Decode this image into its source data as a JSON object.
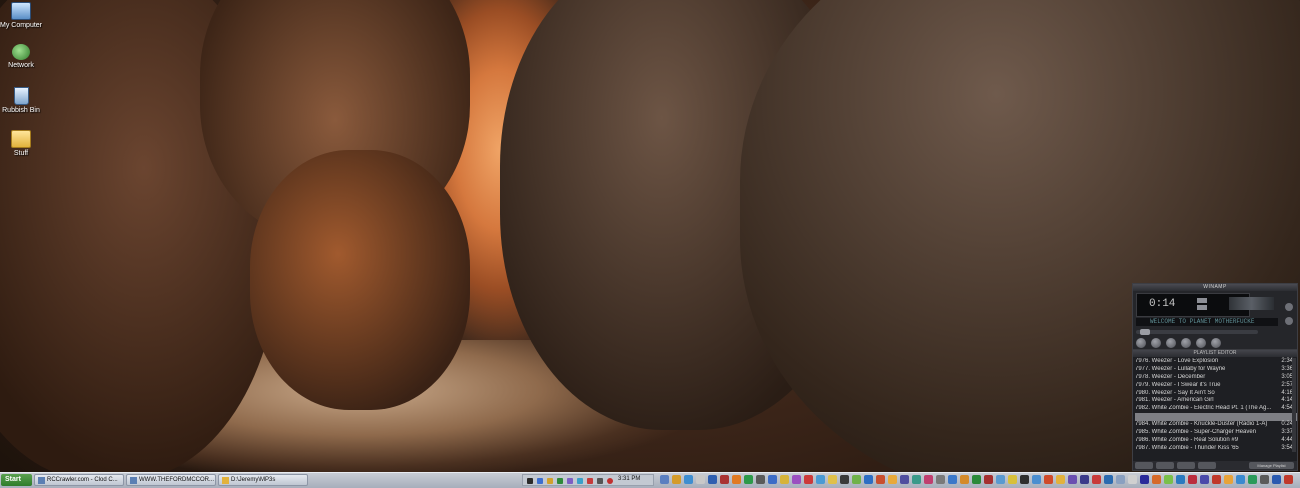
{
  "desktop": {
    "icons": [
      {
        "label": "My Computer",
        "icon": "computer-icon"
      },
      {
        "label": "Network",
        "icon": "network-icon"
      },
      {
        "label": "Rubbish Bin",
        "icon": "recycle-bin-icon"
      },
      {
        "label": "Stuff",
        "icon": "folder-icon"
      }
    ]
  },
  "winamp": {
    "title": "WINAMP",
    "time": "0:14",
    "marquee": "WELCOME TO PLANET MOTHERFUCKE",
    "playlist_title": "PLAYLIST EDITOR",
    "playlist": [
      {
        "title": "7976. Weezer - Love Explosion",
        "duration": "2:34"
      },
      {
        "title": "7977. Weezer - Lullaby for Wayne",
        "duration": "3:36"
      },
      {
        "title": "7978. Weezer - December",
        "duration": "3:05"
      },
      {
        "title": "7979. Weezer - I Swear it's True",
        "duration": "2:57"
      },
      {
        "title": "7980. Weezer - Say It Ain't So",
        "duration": "4:16"
      },
      {
        "title": "7981. Weezer - American Girl",
        "duration": "4:14"
      },
      {
        "title": "7982. White Zombie - Electric Head Pt. 1 (The Ag...",
        "duration": "4:54"
      },
      {
        "title": "",
        "duration": ""
      },
      {
        "title": "7984. White Zombie - Knuckle-Duster (Radio 1-A)",
        "duration": "0:24"
      },
      {
        "title": "7985. White Zombie - Super-Charger Heaven",
        "duration": "3:37"
      },
      {
        "title": "7986. White Zombie - Real Solution #9",
        "duration": "4:44"
      },
      {
        "title": "7987. White Zombie - Thunder Kiss '65",
        "duration": "3:54"
      }
    ],
    "manage_label": "Manage Playlist"
  },
  "taskbar": {
    "start_label": "Start",
    "tasks": [
      {
        "label": "RCCrawler.com - Clod C...",
        "icon": "browser-icon"
      },
      {
        "label": "WWW.THEFORDMCCOR...",
        "icon": "browser-icon"
      },
      {
        "label": "D:\\Jeremy\\MP3s",
        "icon": "folder-icon"
      }
    ],
    "clock": "3:31 PM"
  }
}
